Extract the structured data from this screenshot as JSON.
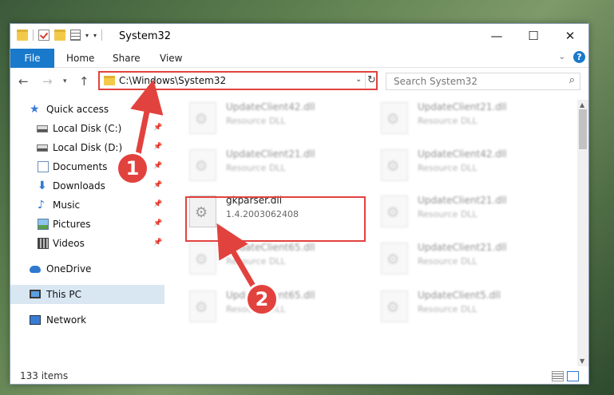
{
  "window": {
    "title": "System32"
  },
  "ribbon": {
    "file": "File",
    "home": "Home",
    "share": "Share",
    "view": "View"
  },
  "addressbar": {
    "path": "C:\\Windows\\System32"
  },
  "search": {
    "placeholder": "Search System32"
  },
  "sidebar": {
    "items": [
      {
        "label": "Quick access"
      },
      {
        "label": "Local Disk (C:)"
      },
      {
        "label": "Local Disk (D:)"
      },
      {
        "label": "Documents"
      },
      {
        "label": "Downloads"
      },
      {
        "label": "Music"
      },
      {
        "label": "Pictures"
      },
      {
        "label": "Videos"
      },
      {
        "label": "OneDrive"
      },
      {
        "label": "This PC"
      },
      {
        "label": "Network"
      }
    ]
  },
  "files": [
    {
      "name": "UpdateClient42.dll",
      "desc": "Resource DLL"
    },
    {
      "name": "UpdateClient21.dll",
      "desc": "Resource DLL"
    },
    {
      "name": "UpdateClient21.dll",
      "desc": "Resource DLL"
    },
    {
      "name": "UpdateClient42.dll",
      "desc": "Resource DLL"
    },
    {
      "name": "gkparser.dll",
      "desc": "1.4.2003062408"
    },
    {
      "name": "UpdateClient21.dll",
      "desc": "Resource DLL"
    },
    {
      "name": "UpdateClient65.dll",
      "desc": "Resource DLL"
    },
    {
      "name": "UpdateClient21.dll",
      "desc": "Resource DLL"
    },
    {
      "name": "UpdateClient65.dll",
      "desc": "Resource DLL"
    },
    {
      "name": "UpdateClient5.dll",
      "desc": "Resource DLL"
    }
  ],
  "status": {
    "items": "133 items"
  },
  "annotations": {
    "step1": "1",
    "step2": "2"
  },
  "colors": {
    "accent": "#1979ca",
    "highlight": "#e2423e",
    "selection": "#d9e7f3"
  }
}
